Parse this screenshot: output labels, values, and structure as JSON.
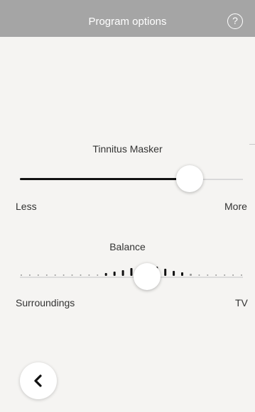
{
  "header": {
    "title": "Program options",
    "help_glyph": "?"
  },
  "tinnitus_masker": {
    "title": "Tinnitus Masker",
    "min_label": "Less",
    "max_label": "More",
    "level": 0.76
  },
  "balance": {
    "title": "Balance",
    "min_label": "Surroundings",
    "max_label": "TV",
    "position": 0.57
  },
  "icons": {
    "help": "question-circle-icon",
    "back": "chevron-left-icon"
  }
}
